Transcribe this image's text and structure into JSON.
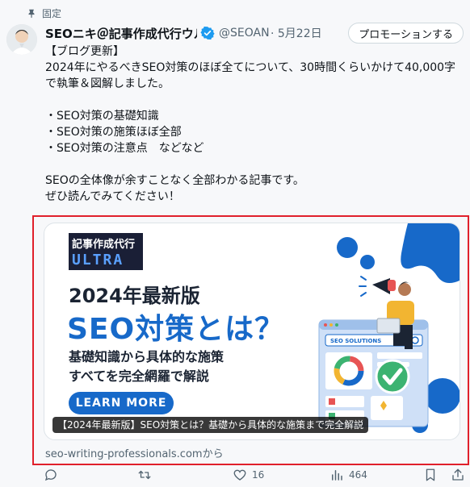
{
  "pinned_label": "固定",
  "author": {
    "name": "SEOニキ＠記事作成代行ウル",
    "handle": "@SEOANI",
    "date": "· 5月22日"
  },
  "promote_label": "プロモーションする",
  "body_text": "【ブログ更新】\n2024年にやるべきSEO対策のほぼ全てについて、30時間くらいかけて40,000字で執筆＆図解しました。\n\n・SEO対策の基礎知識\n・SEO対策の施策ほぼ全部\n・SEO対策の注意点　などなど\n\nSEOの全体像が余すことなく全部わかる記事です。\nぜひ読んでみてください！",
  "card": {
    "brand_top": "記事作成代行",
    "brand_bottom": "ULTRA",
    "headline1": "2024年最新版",
    "headline2": "SEO対策とは？",
    "sub1": "基礎知識から具体的な施策",
    "sub2": "すべてを完全網羅で解説",
    "learn_more": "LEARN MORE",
    "illustration_label": "SEO SOLUTIONS",
    "caption": "【2024年最新版】SEO対策とは？基礎から具体的な施策まで完全解説"
  },
  "source": "seo-writing-professionals.comから",
  "actions": {
    "likes": "16",
    "views": "464"
  },
  "colors": {
    "accent_blue": "#1769c9",
    "verified": "#1d9bf0",
    "highlight_red": "#e0202b"
  }
}
